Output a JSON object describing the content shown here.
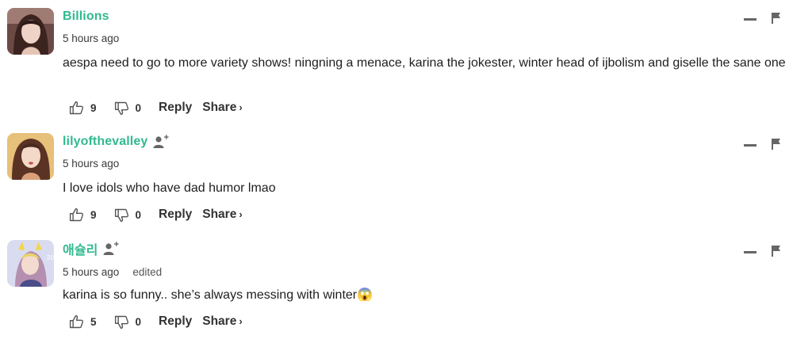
{
  "comments": [
    {
      "username": "Billions",
      "timestamp": "5 hours ago",
      "edited": "",
      "text": "aespa need to go to more variety shows! ningning a menace, karina the jokester, winter head of ijbolism and giselle the sane one",
      "likes": "9",
      "dislikes": "0",
      "reply_label": "Reply",
      "share_label": "Share",
      "share_chevron": "›",
      "has_follow_icon": false
    },
    {
      "username": "lilyofthevalley",
      "timestamp": "5 hours ago",
      "edited": "",
      "text": "I love idols who have dad humor lmao",
      "likes": "9",
      "dislikes": "0",
      "reply_label": "Reply",
      "share_label": "Share",
      "share_chevron": "›",
      "has_follow_icon": true
    },
    {
      "username": "애슐리",
      "timestamp": "5 hours ago",
      "edited": "edited",
      "text": "karina is so funny.. she’s always messing with winter",
      "emoji": "😱",
      "likes": "5",
      "dislikes": "0",
      "reply_label": "Reply",
      "share_label": "Share",
      "share_chevron": "›",
      "has_follow_icon": true
    }
  ],
  "colors": {
    "username": "#31b98f",
    "text": "#1e1e1e",
    "icon": "#666666"
  },
  "icons": {
    "like": "thumbs-up-icon",
    "dislike": "thumbs-down-icon",
    "minimize": "minus-icon",
    "flag": "flag-icon",
    "follow": "add-user-icon"
  }
}
